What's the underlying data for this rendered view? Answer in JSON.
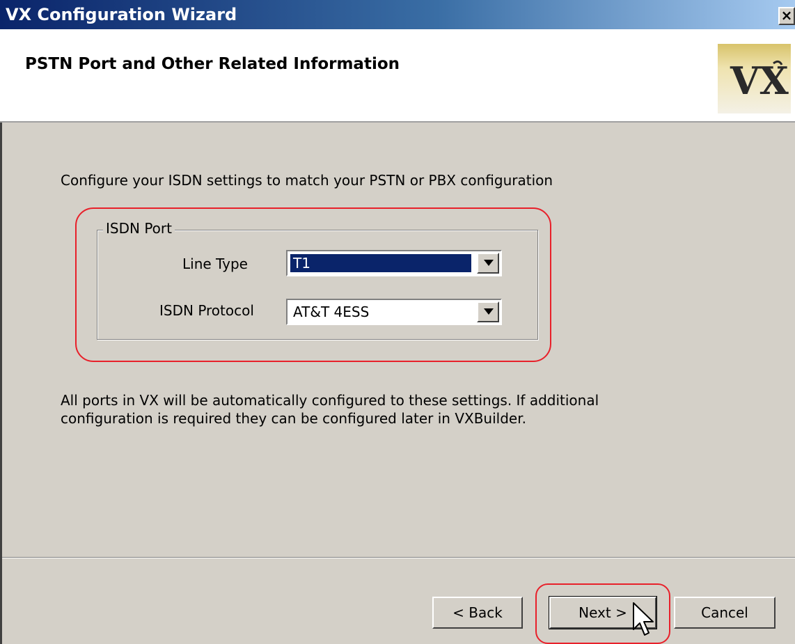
{
  "window": {
    "title": "VX Configuration Wizard",
    "close_glyph": "×"
  },
  "header": {
    "title": "PSTN Port and Other Related Information",
    "logo_text": "VX",
    "logo_colors": [
      "#d8c36a",
      "#f4f1e6"
    ]
  },
  "content": {
    "instruction": "Configure your ISDN settings to match your PSTN or PBX configuration",
    "isdn_port": {
      "group_label": "ISDN Port",
      "line_type_label": "Line Type",
      "line_type_value": "T1",
      "protocol_label": "ISDN Protocol",
      "protocol_value": "AT&T 4ESS"
    },
    "note": "All ports in VX will be automatically configured to these settings. If additional configuration is required they can be configured later in VXBuilder."
  },
  "buttons": {
    "back": "< Back",
    "next": "Next >",
    "cancel": "Cancel"
  },
  "highlight_color": "#e8202a",
  "icons": [
    "close-icon",
    "dropdown-arrow-icon",
    "mouse-pointer-icon",
    "vx-logo"
  ]
}
